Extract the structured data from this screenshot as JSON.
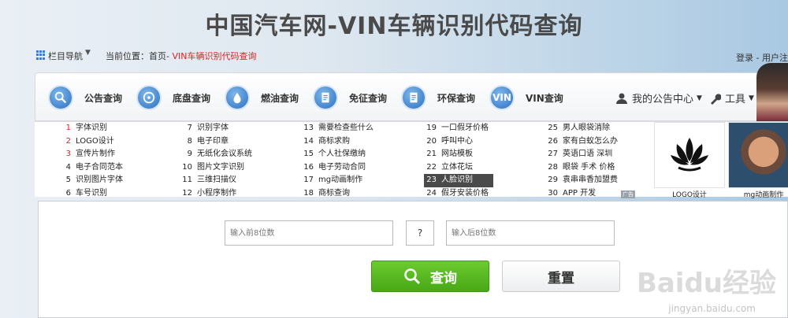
{
  "header": {
    "title": "中国汽车网-VIN车辆识别代码查询",
    "nav_menu_label": "栏目导航",
    "breadcrumb_prefix": "当前位置：首页- ",
    "breadcrumb_current": "VIN车辆识别代码查询",
    "login_text": "登录 - 用户注"
  },
  "nav": {
    "items": [
      {
        "label": "公告查询",
        "icon": "search-icon"
      },
      {
        "label": "底盘查询",
        "icon": "gauge-icon"
      },
      {
        "label": "燃油查询",
        "icon": "fuel-drop-icon"
      },
      {
        "label": "免征查询",
        "icon": "document-icon"
      },
      {
        "label": "环保查询",
        "icon": "document-icon"
      },
      {
        "label": "VIN查询",
        "icon": "vin-icon",
        "badge": "VIN"
      }
    ],
    "my_center": "我的公告中心",
    "tools": "工具"
  },
  "links": {
    "columns": [
      [
        {
          "n": "1",
          "t": "字体识别"
        },
        {
          "n": "2",
          "t": "LOGO设计"
        },
        {
          "n": "3",
          "t": "宣传片制作"
        },
        {
          "n": "4",
          "t": "电子合同范本"
        },
        {
          "n": "5",
          "t": "识别图片字体"
        },
        {
          "n": "6",
          "t": "车号识别"
        }
      ],
      [
        {
          "n": "7",
          "t": "识别字体"
        },
        {
          "n": "8",
          "t": "电子印章"
        },
        {
          "n": "9",
          "t": "无纸化会议系统"
        },
        {
          "n": "10",
          "t": "图片文字识别"
        },
        {
          "n": "11",
          "t": "三维扫描仪"
        },
        {
          "n": "12",
          "t": "小程序制作"
        }
      ],
      [
        {
          "n": "13",
          "t": "需要检查些什么"
        },
        {
          "n": "14",
          "t": "商标求购"
        },
        {
          "n": "15",
          "t": "个人社保缴纳"
        },
        {
          "n": "16",
          "t": "电子劳动合同"
        },
        {
          "n": "17",
          "t": "mg动画制作"
        },
        {
          "n": "18",
          "t": "商标查询"
        }
      ],
      [
        {
          "n": "19",
          "t": "一口假牙价格"
        },
        {
          "n": "20",
          "t": "呼叫中心"
        },
        {
          "n": "21",
          "t": "网站模板"
        },
        {
          "n": "22",
          "t": "立体花坛"
        },
        {
          "n": "23",
          "t": "人脸识别"
        },
        {
          "n": "24",
          "t": "假牙安装价格"
        }
      ],
      [
        {
          "n": "25",
          "t": "男人眼袋消除"
        },
        {
          "n": "26",
          "t": "家有白蚁怎么办"
        },
        {
          "n": "27",
          "t": "英语口语 深圳"
        },
        {
          "n": "28",
          "t": "眼袋 手术 价格"
        },
        {
          "n": "29",
          "t": "袁串串香加盟费"
        },
        {
          "n": "30",
          "t": "APP 开发"
        }
      ]
    ],
    "highlight": "23",
    "ad_tag": "广告",
    "ads": [
      {
        "caption": "LOGO设计"
      },
      {
        "caption": "mg动画制作"
      }
    ]
  },
  "form": {
    "front_placeholder": "输入前8位数",
    "check_digit": "?",
    "back_placeholder": "输入后8位数",
    "query_label": "查询",
    "reset_label": "重置"
  },
  "watermark": {
    "text": "Baidu经验",
    "url": "jingyan.baidu.com"
  },
  "colors": {
    "accent_red": "#e02020",
    "query_green": "#52b51e",
    "nav_blue": "#2c6fc0"
  }
}
